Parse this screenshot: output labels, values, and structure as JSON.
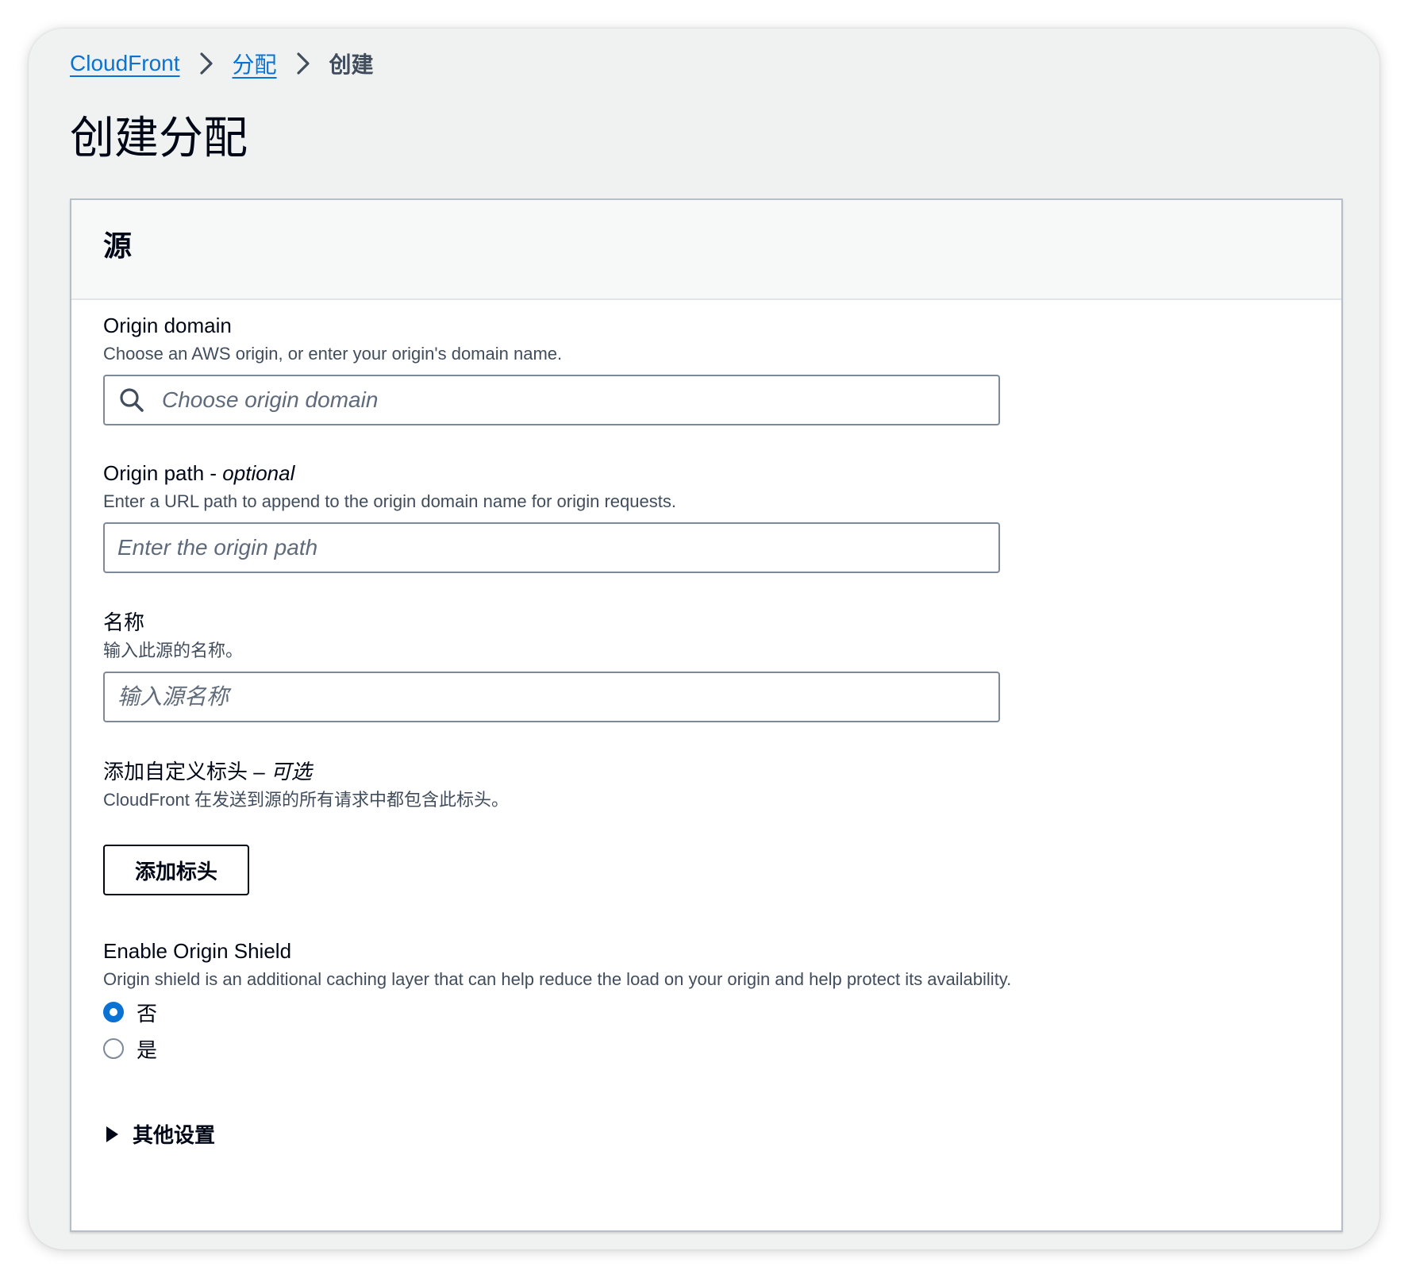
{
  "breadcrumb": {
    "items": [
      "CloudFront",
      "分配"
    ],
    "current": "创建"
  },
  "page": {
    "title": "创建分配"
  },
  "panel": {
    "title": "源"
  },
  "origin_domain": {
    "label": "Origin domain",
    "description": "Choose an AWS origin, or enter your origin's domain name.",
    "placeholder": "Choose origin domain",
    "value": ""
  },
  "origin_path": {
    "label": "Origin path - ",
    "optional": "optional",
    "description": "Enter a URL path to append to the origin domain name for origin requests.",
    "placeholder": "Enter the origin path",
    "value": ""
  },
  "name": {
    "label": "名称",
    "description": "输入此源的名称。",
    "placeholder": "输入源名称",
    "value": ""
  },
  "custom_headers": {
    "label": "添加自定义标头 – ",
    "optional": "可选",
    "description": "CloudFront 在发送到源的所有请求中都包含此标头。",
    "button_label": "添加标头"
  },
  "origin_shield": {
    "label": "Enable Origin Shield",
    "description": "Origin shield is an additional caching layer that can help reduce the load on your origin and help protect its availability.",
    "options": [
      {
        "label": "否",
        "checked": true
      },
      {
        "label": "是",
        "checked": false
      }
    ]
  },
  "additional_settings": {
    "label": "其他设置",
    "expanded": false
  },
  "colors": {
    "link": "#0972d3",
    "text": "#000716",
    "secondary_text": "#414d5c",
    "background": "#f0f1f1",
    "radio_selected": "#0972d3"
  }
}
